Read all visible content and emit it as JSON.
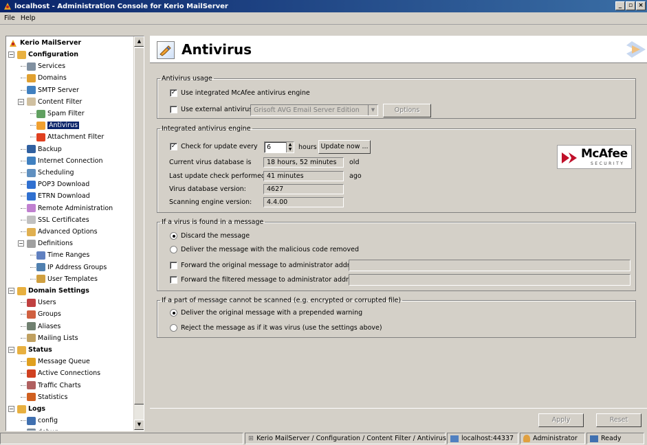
{
  "window": {
    "title": "localhost - Administration Console for Kerio MailServer",
    "min": "_",
    "max": "▫",
    "close": "×"
  },
  "menu": [
    "File",
    "Help"
  ],
  "tree": {
    "root": "Kerio MailServer",
    "items": [
      {
        "label": "Configuration",
        "bold": true
      },
      {
        "label": "Services"
      },
      {
        "label": "Domains"
      },
      {
        "label": "SMTP Server"
      },
      {
        "label": "Content Filter"
      },
      {
        "label": "Spam Filter"
      },
      {
        "label": "Antivirus"
      },
      {
        "label": "Attachment Filter"
      },
      {
        "label": "Backup"
      },
      {
        "label": "Internet Connection"
      },
      {
        "label": "Scheduling"
      },
      {
        "label": "POP3 Download"
      },
      {
        "label": "ETRN Download"
      },
      {
        "label": "Remote Administration"
      },
      {
        "label": "SSL Certificates"
      },
      {
        "label": "Advanced Options"
      },
      {
        "label": "Definitions"
      },
      {
        "label": "Time Ranges"
      },
      {
        "label": "IP Address Groups"
      },
      {
        "label": "User Templates"
      },
      {
        "label": "Domain Settings",
        "bold": true
      },
      {
        "label": "Users"
      },
      {
        "label": "Groups"
      },
      {
        "label": "Aliases"
      },
      {
        "label": "Mailing Lists"
      },
      {
        "label": "Status",
        "bold": true
      },
      {
        "label": "Message Queue"
      },
      {
        "label": "Active Connections"
      },
      {
        "label": "Traffic Charts"
      },
      {
        "label": "Statistics"
      },
      {
        "label": "Logs",
        "bold": true
      },
      {
        "label": "config"
      },
      {
        "label": "debug"
      }
    ]
  },
  "page": {
    "title": "Antivirus"
  },
  "usage": {
    "legend": "Antivirus usage",
    "use_mcafee": "Use integrated McAfee antivirus engine",
    "use_mcafee_checked": "✓",
    "use_external": "Use external antivirus",
    "external_select": "Grisoft AVG Email Server Edition",
    "options_button": "Options"
  },
  "engine": {
    "legend": "Integrated antivirus engine",
    "check_update": "Check for update every",
    "check_checked": "✓",
    "hours_value": "6",
    "hours_label": "hours",
    "update_now": "Update now ...",
    "db_age_label": "Current virus database is",
    "db_age_value": "18 hours, 52 minutes",
    "db_age_suffix": "old",
    "last_check_label": "Last update check performed",
    "last_check_value": "41 minutes",
    "last_check_suffix": "ago",
    "db_version_label": "Virus database version:",
    "db_version_value": "4627",
    "engine_version_label": "Scanning engine version:",
    "engine_version_value": "4.4.00",
    "logo_text": "McAfee",
    "logo_sub": "SECURITY"
  },
  "virus_found": {
    "legend": "If a virus is found in a message",
    "discard": "Discard the message",
    "deliver_removed": "Deliver the message with the malicious code removed",
    "forward_original": "Forward the original message to administrator address:",
    "forward_filtered": "Forward the filtered message to administrator address:"
  },
  "unscannable": {
    "legend": "If a part of message cannot be scanned (e.g. encrypted or corrupted file)",
    "deliver_warning": "Deliver the original message with a prepended warning",
    "reject": "Reject the message as if it was virus (use the settings above)"
  },
  "buttons": {
    "apply": "Apply",
    "reset": "Reset"
  },
  "status": {
    "path": "Kerio MailServer / Configuration / Content Filter / Antivirus",
    "host": "localhost:44337",
    "user": "Administrator",
    "state": "Ready"
  },
  "colors": {
    "titlebar": "#0a246a",
    "selection": "#0a246a",
    "face": "#d4d0c8"
  }
}
